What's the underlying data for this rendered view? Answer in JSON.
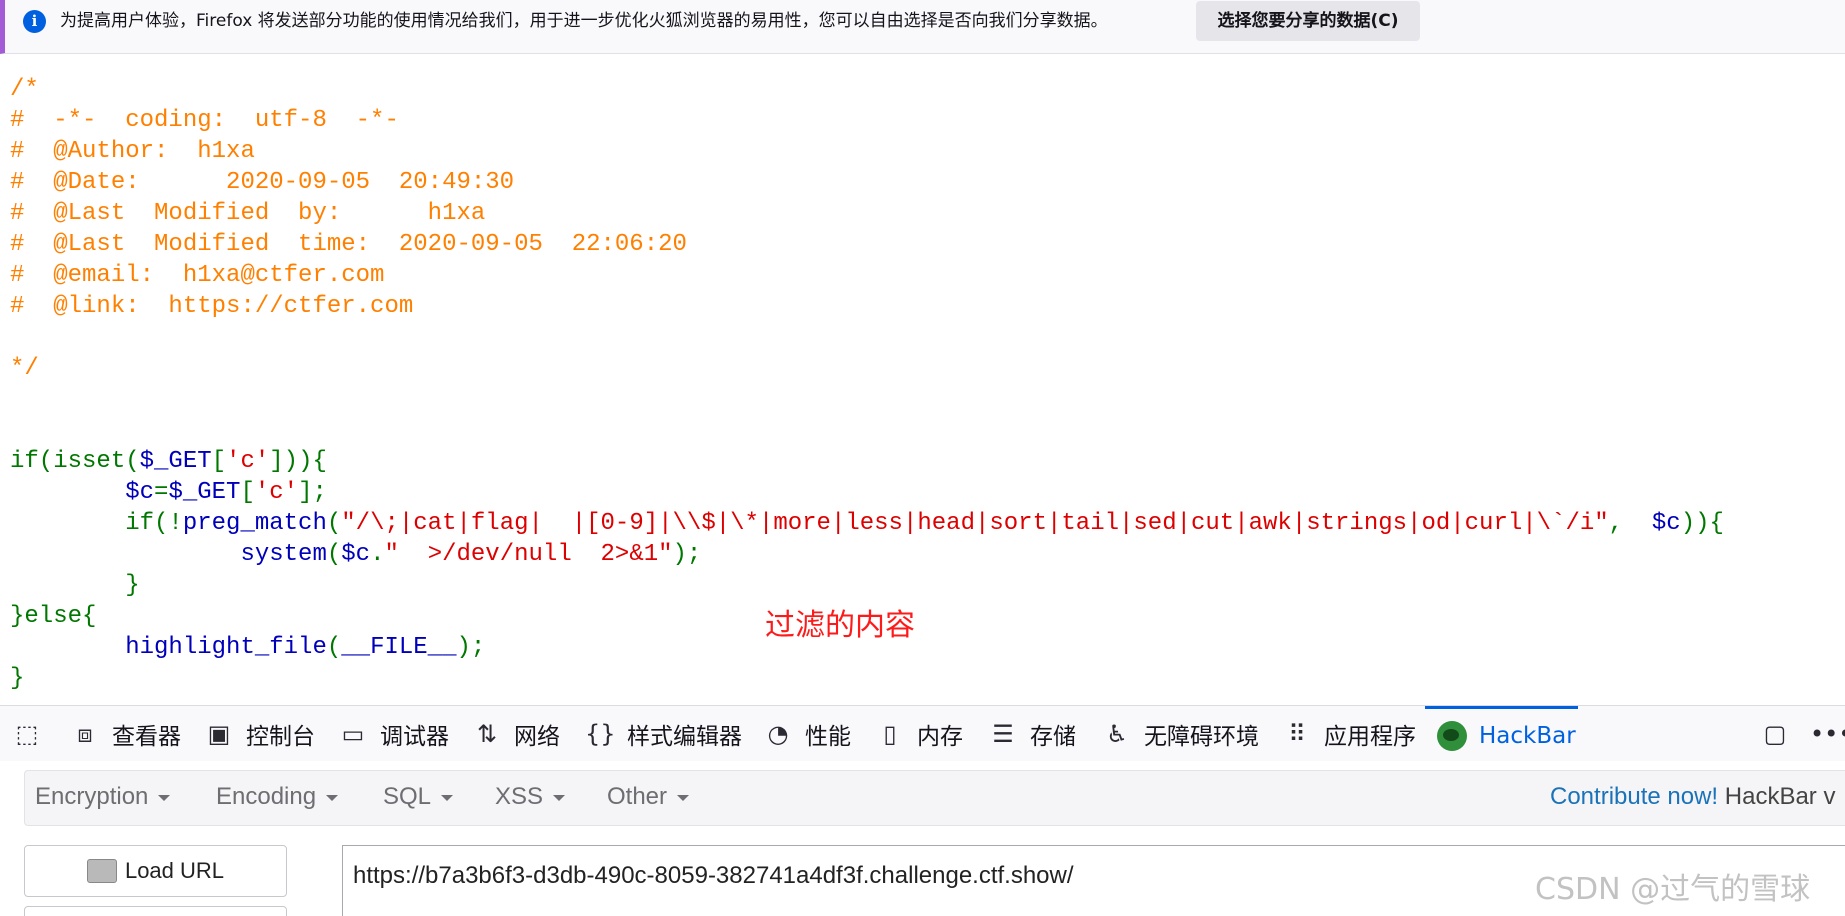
{
  "notification": {
    "icon": "info-icon",
    "message": "为提高用户体验，Firefox 将发送部分功能的使用情况给我们，用于进一步优化火狐浏览器的易用性，您可以自由选择是否向我们分享数据。",
    "button_label": "选择您要分享的数据(C)"
  },
  "code_lines": [
    [
      {
        "t": "/*",
        "c": "c"
      }
    ],
    [
      {
        "t": "#  -*-  coding:  utf-8  -*-",
        "c": "c"
      }
    ],
    [
      {
        "t": "#  @Author:  h1xa",
        "c": "c"
      }
    ],
    [
      {
        "t": "#  @Date:      2020-09-05  20:49:30",
        "c": "c"
      }
    ],
    [
      {
        "t": "#  @Last  Modified  by:      h1xa",
        "c": "c"
      }
    ],
    [
      {
        "t": "#  @Last  Modified  time:  2020-09-05  22:06:20",
        "c": "c"
      }
    ],
    [
      {
        "t": "#  @email:  h1xa@ctfer.com",
        "c": "c"
      }
    ],
    [
      {
        "t": "#  @link:  https://ctfer.com",
        "c": "c"
      }
    ],
    [],
    [
      {
        "t": "*/",
        "c": "c"
      }
    ],
    [],
    [],
    [
      {
        "t": "if(isset(",
        "c": "g"
      },
      {
        "t": "$_GET",
        "c": "b"
      },
      {
        "t": "[",
        "c": "g"
      },
      {
        "t": "'c'",
        "c": "r"
      },
      {
        "t": "])){",
        "c": "g"
      }
    ],
    [
      {
        "t": "        ",
        "c": "g"
      },
      {
        "t": "$c",
        "c": "b"
      },
      {
        "t": "=",
        "c": "g"
      },
      {
        "t": "$_GET",
        "c": "b"
      },
      {
        "t": "[",
        "c": "g"
      },
      {
        "t": "'c'",
        "c": "r"
      },
      {
        "t": "];",
        "c": "g"
      }
    ],
    [
      {
        "t": "        if(!",
        "c": "g"
      },
      {
        "t": "preg_match",
        "c": "b"
      },
      {
        "t": "(",
        "c": "g"
      },
      {
        "t": "\"/\\;|cat|flag|  |[0-9]|\\\\$|\\*|more|less|head|sort|tail|sed|cut|awk|strings|od|curl|\\`/i\"",
        "c": "r"
      },
      {
        "t": ",  ",
        "c": "g"
      },
      {
        "t": "$c",
        "c": "b"
      },
      {
        "t": ")){",
        "c": "g"
      }
    ],
    [
      {
        "t": "                ",
        "c": "g"
      },
      {
        "t": "system",
        "c": "b"
      },
      {
        "t": "(",
        "c": "g"
      },
      {
        "t": "$c",
        "c": "b"
      },
      {
        "t": ".",
        "c": "g"
      },
      {
        "t": "\"  >/dev/null  2>&1\"",
        "c": "r"
      },
      {
        "t": ");",
        "c": "g"
      }
    ],
    [
      {
        "t": "        }",
        "c": "g"
      }
    ],
    [
      {
        "t": "}else{",
        "c": "g"
      }
    ],
    [
      {
        "t": "        ",
        "c": "g"
      },
      {
        "t": "highlight_file",
        "c": "b"
      },
      {
        "t": "(",
        "c": "g"
      },
      {
        "t": "__FILE__",
        "c": "b"
      },
      {
        "t": ");",
        "c": "g"
      }
    ],
    [
      {
        "t": "}",
        "c": "g"
      }
    ]
  ],
  "annotation": "过滤的内容",
  "devtools": {
    "tabs": [
      {
        "label": "",
        "icon": "picker-icon"
      },
      {
        "label": "查看器",
        "icon": "inspector-icon"
      },
      {
        "label": "控制台",
        "icon": "console-icon"
      },
      {
        "label": "调试器",
        "icon": "debugger-icon"
      },
      {
        "label": "网络",
        "icon": "network-icon"
      },
      {
        "label": "样式编辑器",
        "icon": "style-editor-icon"
      },
      {
        "label": "性能",
        "icon": "performance-icon"
      },
      {
        "label": "内存",
        "icon": "memory-icon"
      },
      {
        "label": "存储",
        "icon": "storage-icon"
      },
      {
        "label": "无障碍环境",
        "icon": "accessibility-icon"
      },
      {
        "label": "应用程序",
        "icon": "application-icon"
      },
      {
        "label": "HackBar",
        "icon": "hackbar-icon",
        "active": true
      }
    ]
  },
  "hackbar": {
    "menus": [
      "Encryption",
      "Encoding",
      "SQL",
      "XSS",
      "Other"
    ],
    "contribute_link": "Contribute now!",
    "contribute_text": "HackBar v",
    "load_url_label": "Load URL",
    "url_value": "https://b7a3b6f3-d3db-490c-8059-382741a4df3f.challenge.ctf.show/"
  },
  "watermark": "CSDN @过气的雪球"
}
